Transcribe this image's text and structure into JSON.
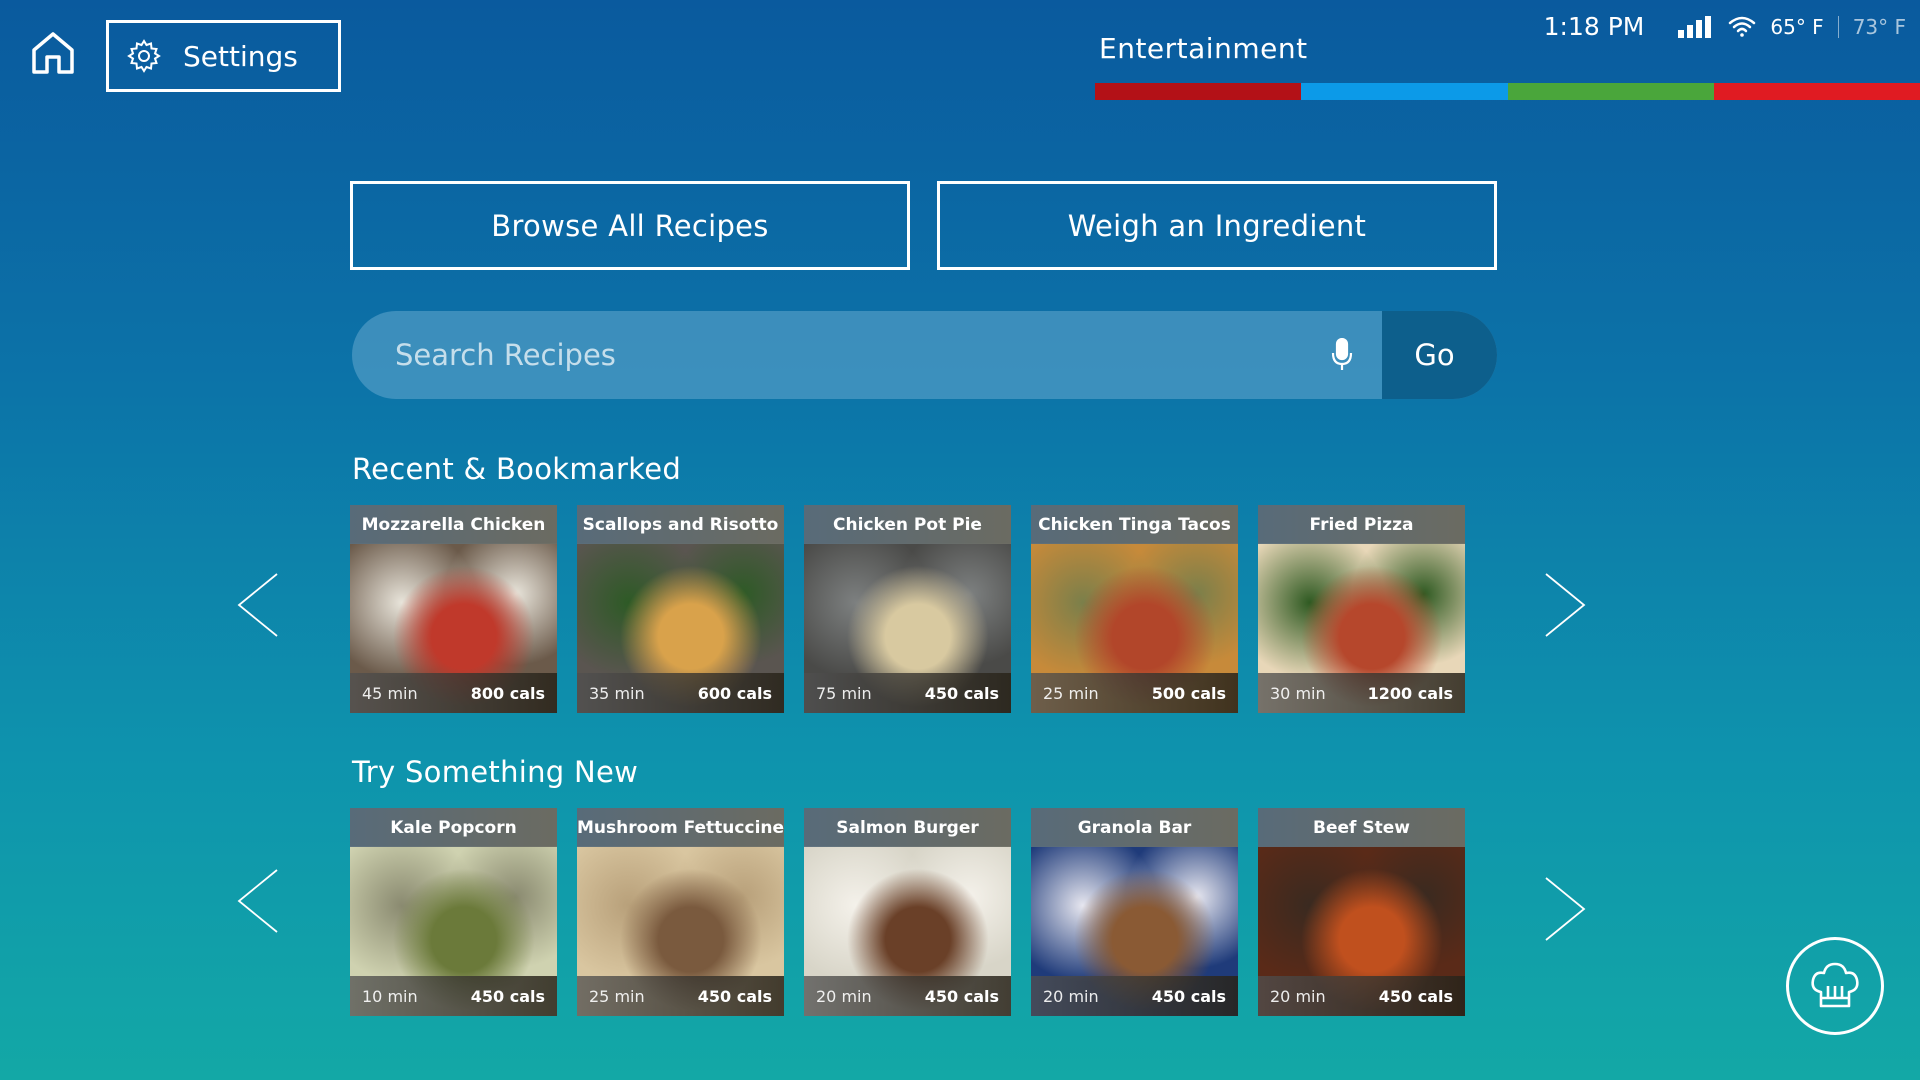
{
  "header": {
    "settings_label": "Settings",
    "mode_title": "Entertainment",
    "mode_bar_colors": [
      "#b31117",
      "#0c9ae8",
      "#4aa63b",
      "#e01b22"
    ],
    "status": {
      "time": "1:18 PM",
      "indoor_temp": "65° F",
      "outdoor_temp": "73° F"
    }
  },
  "actions": {
    "browse_label": "Browse All Recipes",
    "weigh_label": "Weigh an Ingredient"
  },
  "search": {
    "placeholder": "Search Recipes",
    "go_label": "Go"
  },
  "sections": {
    "recent": {
      "title": "Recent & Bookmarked",
      "cards": [
        {
          "title": "Mozzarella Chicken",
          "time": "45 min",
          "cals": "800 cals",
          "colors": [
            "#6b5a4a",
            "#c0392b",
            "#e8e4da"
          ]
        },
        {
          "title": "Scallops and Risotto",
          "time": "35 min",
          "cals": "600 cals",
          "colors": [
            "#5a5550",
            "#d9a24b",
            "#2e5a26"
          ]
        },
        {
          "title": "Chicken Pot Pie",
          "time": "75 min",
          "cals": "450 cals",
          "colors": [
            "#4a4a48",
            "#d8c9a0",
            "#7d8080"
          ]
        },
        {
          "title": "Chicken Tinga Tacos",
          "time": "25 min",
          "cals": "500 cals",
          "colors": [
            "#c78a3a",
            "#b2462a",
            "#7b7f4a"
          ]
        },
        {
          "title": "Fried Pizza",
          "time": "30 min",
          "cals": "1200 cals",
          "colors": [
            "#e8d7b8",
            "#b6472c",
            "#2f5a22"
          ]
        }
      ]
    },
    "new": {
      "title": "Try Something New",
      "cards": [
        {
          "title": "Kale Popcorn",
          "time": "10 min",
          "cals": "450 cals",
          "colors": [
            "#cfd2b0",
            "#6b7a3a",
            "#8a8a70"
          ]
        },
        {
          "title": "Mushroom Fettuccine",
          "time": "25 min",
          "cals": "450 cals",
          "colors": [
            "#d9c6a0",
            "#7a5a3e",
            "#b8a07a"
          ]
        },
        {
          "title": "Salmon Burger",
          "time": "20 min",
          "cals": "450 cals",
          "colors": [
            "#d8d5c8",
            "#6a4028",
            "#f4f1ea"
          ]
        },
        {
          "title": "Granola Bar",
          "time": "20 min",
          "cals": "450 cals",
          "colors": [
            "#1f3b7a",
            "#8a5a34",
            "#e6e6ef"
          ]
        },
        {
          "title": "Beef Stew",
          "time": "20 min",
          "cals": "450 cals",
          "colors": [
            "#5a2a18",
            "#c0501e",
            "#3a2a20"
          ]
        }
      ]
    }
  },
  "icons": {
    "home": "home-icon",
    "settings": "gear-icon",
    "mic": "microphone-icon",
    "arrow_left": "chevron-left-icon",
    "arrow_right": "chevron-right-icon",
    "chef": "chef-hat-icon"
  }
}
